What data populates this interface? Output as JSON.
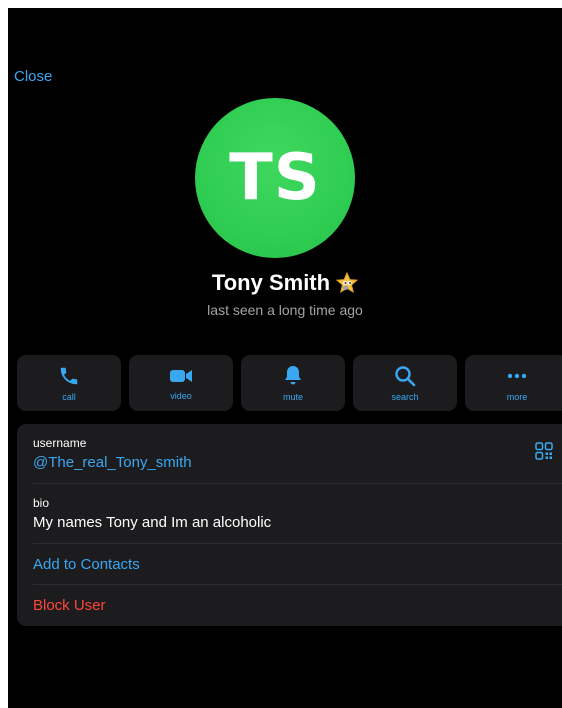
{
  "header": {
    "close_label": "Close"
  },
  "profile": {
    "initials": "TS",
    "name": "Tony Smith",
    "status": "last seen a long time ago",
    "avatar_color": "#2fcd52",
    "emoji_status_icon": "star-emoji-icon"
  },
  "actions": [
    {
      "label": "call",
      "icon": "phone-icon"
    },
    {
      "label": "video",
      "icon": "video-camera-icon"
    },
    {
      "label": "mute",
      "icon": "bell-icon"
    },
    {
      "label": "search",
      "icon": "search-icon"
    },
    {
      "label": "more",
      "icon": "more-dots-icon"
    }
  ],
  "info": {
    "username_label": "username",
    "username_value": "@The_real_Tony_smith",
    "bio_label": "bio",
    "bio_value": "My names Tony and Im an alcoholic",
    "add_contact_label": "Add to Contacts",
    "block_label": "Block User",
    "qr_icon": "qr-code-icon"
  },
  "colors": {
    "accent": "#3aa7f2",
    "danger": "#ff453a",
    "background": "#000000",
    "card": "#1c1c1e"
  }
}
